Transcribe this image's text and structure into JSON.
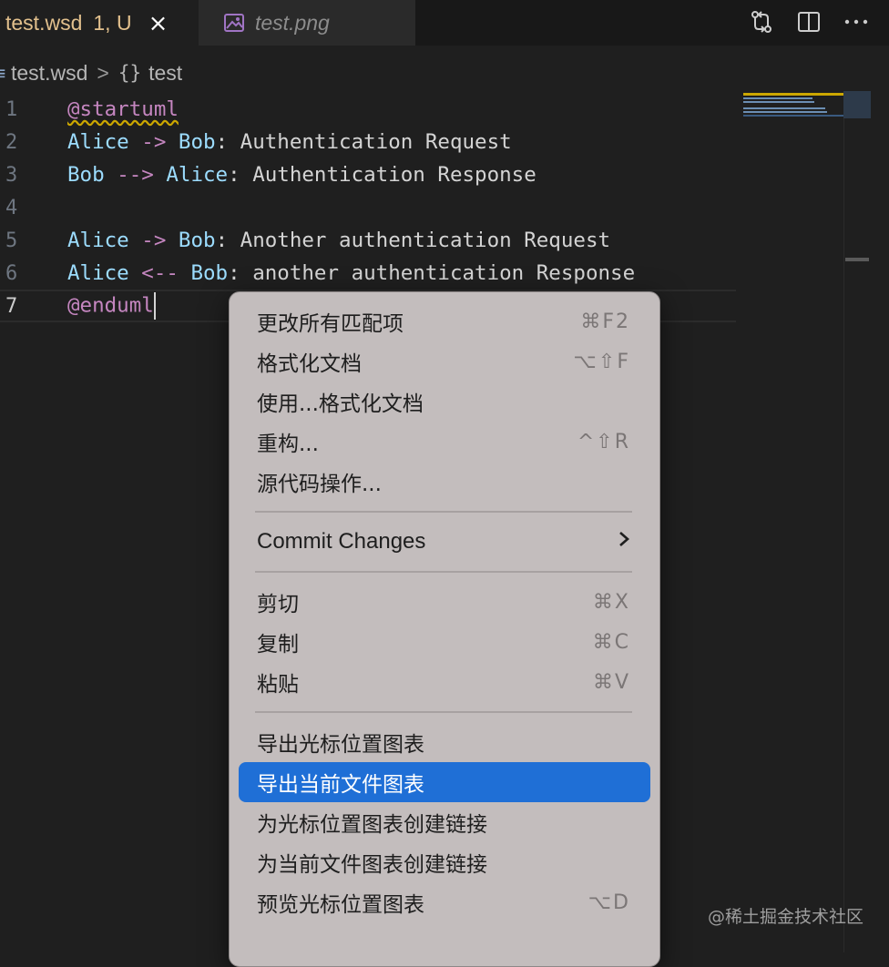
{
  "tabs": [
    {
      "title": "test.wsd",
      "status": "1, U",
      "active": true,
      "close_icon": "×"
    },
    {
      "title": "test.png",
      "active": false
    }
  ],
  "editor_actions": [
    "source-control-compare-icon",
    "split-editor-icon",
    "more-actions-icon"
  ],
  "breadcrumb": {
    "file": "test.wsd",
    "separator": ">",
    "symbol_icon": "{}",
    "symbol": "test"
  },
  "editor": {
    "lines": [
      {
        "number": "1",
        "tokens": [
          {
            "t": "@startuml",
            "c": "kw squig"
          }
        ]
      },
      {
        "number": "2",
        "tokens": [
          {
            "t": "Alice",
            "c": "id"
          },
          {
            "t": " ",
            "c": "txt"
          },
          {
            "t": "->",
            "c": "arr"
          },
          {
            "t": " ",
            "c": "txt"
          },
          {
            "t": "Bob",
            "c": "id"
          },
          {
            "t": ": Authentication Request",
            "c": "txt"
          }
        ]
      },
      {
        "number": "3",
        "tokens": [
          {
            "t": "Bob",
            "c": "id"
          },
          {
            "t": " ",
            "c": "txt"
          },
          {
            "t": "-->",
            "c": "arr"
          },
          {
            "t": " ",
            "c": "txt"
          },
          {
            "t": "Alice",
            "c": "id"
          },
          {
            "t": ": Authentication Response",
            "c": "txt"
          }
        ]
      },
      {
        "number": "4",
        "tokens": []
      },
      {
        "number": "5",
        "tokens": [
          {
            "t": "Alice",
            "c": "id"
          },
          {
            "t": " ",
            "c": "txt"
          },
          {
            "t": "->",
            "c": "arr"
          },
          {
            "t": " ",
            "c": "txt"
          },
          {
            "t": "Bob",
            "c": "id"
          },
          {
            "t": ": Another authentication Request",
            "c": "txt"
          }
        ]
      },
      {
        "number": "6",
        "tokens": [
          {
            "t": "Alice",
            "c": "id"
          },
          {
            "t": " ",
            "c": "txt"
          },
          {
            "t": "<--",
            "c": "arr"
          },
          {
            "t": " ",
            "c": "txt"
          },
          {
            "t": "Bob",
            "c": "id"
          },
          {
            "t": ": another authentication Response",
            "c": "txt"
          }
        ]
      },
      {
        "number": "7",
        "tokens": [
          {
            "t": "@enduml",
            "c": "kw"
          }
        ],
        "current": true
      }
    ]
  },
  "context_menu": {
    "groups": [
      [
        {
          "label": "更改所有匹配项",
          "shortcut": "⌘F2"
        },
        {
          "label": "格式化文档",
          "shortcut": "⌥⇧F"
        },
        {
          "label": "使用...格式化文档",
          "shortcut": ""
        },
        {
          "label": "重构...",
          "shortcut": "^⇧R"
        },
        {
          "label": "源代码操作...",
          "shortcut": ""
        }
      ],
      [
        {
          "label": "Commit Changes",
          "shortcut": "",
          "submenu": true
        }
      ],
      [
        {
          "label": "剪切",
          "shortcut": "⌘X"
        },
        {
          "label": "复制",
          "shortcut": "⌘C"
        },
        {
          "label": "粘贴",
          "shortcut": "⌘V"
        }
      ],
      [
        {
          "label": "导出光标位置图表",
          "shortcut": ""
        },
        {
          "label": "导出当前文件图表",
          "shortcut": "",
          "highlighted": true
        },
        {
          "label": "为光标位置图表创建链接",
          "shortcut": ""
        },
        {
          "label": "为当前文件图表创建链接",
          "shortcut": ""
        },
        {
          "label": "预览光标位置图表",
          "shortcut": "⌥D"
        }
      ]
    ]
  },
  "colors": {
    "highlight": "#1f6fd6",
    "keyword": "#c586c0",
    "identifier": "#9cdcfe",
    "modified": "#e2c08d"
  },
  "watermark": "@稀土掘金技术社区"
}
